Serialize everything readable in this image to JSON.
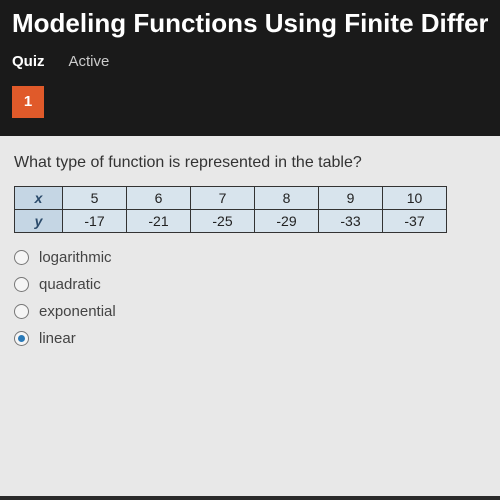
{
  "header": {
    "title": "Modeling Functions Using Finite Differ"
  },
  "tabs": {
    "quiz": "Quiz",
    "active": "Active"
  },
  "nav": {
    "current": "1"
  },
  "question": {
    "prompt": "What type of function is represented in the table?",
    "table": {
      "xlabel": "x",
      "ylabel": "y",
      "x": [
        "5",
        "6",
        "7",
        "8",
        "9",
        "10"
      ],
      "y": [
        "-17",
        "-21",
        "-25",
        "-29",
        "-33",
        "-37"
      ]
    },
    "options": [
      {
        "label": "logarithmic",
        "selected": false
      },
      {
        "label": "quadratic",
        "selected": false
      },
      {
        "label": "exponential",
        "selected": false
      },
      {
        "label": "linear",
        "selected": true
      }
    ]
  },
  "chart_data": {
    "type": "table",
    "title": "What type of function is represented in the table?",
    "categories": [
      5,
      6,
      7,
      8,
      9,
      10
    ],
    "series": [
      {
        "name": "y",
        "values": [
          -17,
          -21,
          -25,
          -29,
          -33,
          -37
        ]
      }
    ],
    "xlabel": "x",
    "ylabel": "y"
  }
}
